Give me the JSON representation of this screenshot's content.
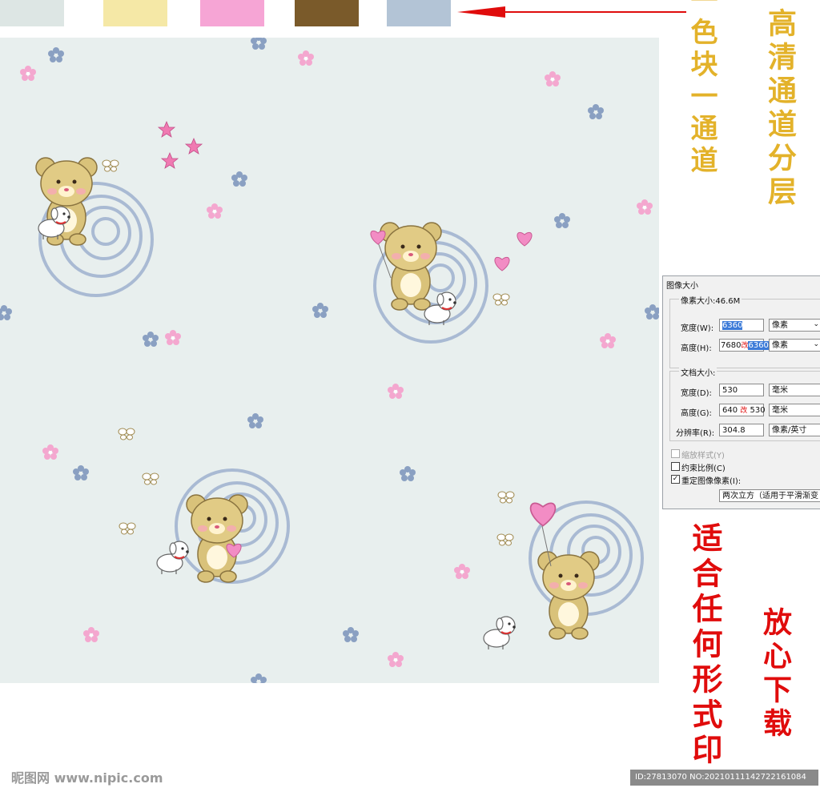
{
  "swatches": {
    "colors": [
      "#dde6e4",
      "#f5e8a6",
      "#f6a5d5",
      "#7a5a2a",
      "#b3c4d6"
    ]
  },
  "captions": {
    "color_block": "一色块一通道",
    "hd_layers": "高清通道分层",
    "print": "适合任何形式印",
    "download": "放心下载"
  },
  "pattern": {
    "background": "#e8efee",
    "motifs": [
      "teddy-bear-icon",
      "puppy-icon",
      "heart-balloon-icon",
      "star-icon",
      "flower-icon",
      "butterfly-icon",
      "swirl-icon"
    ]
  },
  "dialog": {
    "title": "图像大小",
    "pixel_size_label": "像素大小:46.6M",
    "width_label": "宽度(W):",
    "width_value": "6360",
    "width_unit": "像素",
    "height_label": "高度(H):",
    "height_value_old": "7680",
    "height_mark": "改",
    "height_value_new": "6360",
    "height_unit": "像素",
    "doc_size_label": "文档大小:",
    "doc_width_label": "宽度(D):",
    "doc_width_value": "530",
    "doc_width_unit": "毫米",
    "doc_height_label": "高度(G):",
    "doc_height_value_old": "640",
    "doc_height_mark": "改",
    "doc_height_value_new": "530",
    "doc_height_unit": "毫米",
    "resolution_label": "分辨率(R):",
    "resolution_value": "304.8",
    "resolution_unit": "像素/英寸",
    "scale_styles": "缩放样式(Y)",
    "constrain": "约束比例(C)",
    "resample": "重定图像像素(I):",
    "resample_method": "两次立方（适用于平滑渐变"
  },
  "footer": {
    "watermark": "昵图网 www.nipic.com",
    "id_text": "ID:27813070 NO:20210111142722161084"
  }
}
